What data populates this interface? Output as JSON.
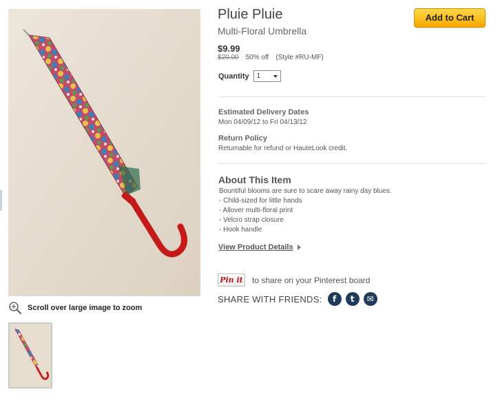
{
  "product": {
    "brand": "Pluie Pluie",
    "name": "Multi-Floral Umbrella",
    "price": "$9.99",
    "original_price": "$20.00",
    "discount": "50% off",
    "style": "(Style #RU-MF)"
  },
  "cart": {
    "add_label": "Add to Cart"
  },
  "quantity": {
    "label": "Quantity",
    "value": "1"
  },
  "delivery": {
    "title": "Estimated Delivery Dates",
    "text": "Mon 04/09/12 to Fri 04/13/12"
  },
  "returns": {
    "title": "Return Policy",
    "text": "Returnable for refund or HauteLook credit."
  },
  "about": {
    "title": "About This Item",
    "intro": "Bountiful blooms are sure to scare away rainy day blues.",
    "bullets": [
      "- Child-sized for little hands",
      "- Allover multi-floral print",
      "- Velcro strap closure",
      "- Hook handle"
    ],
    "details_link": "View Product Details"
  },
  "pinterest": {
    "button_label": "Pin it",
    "text": "to share on your Pinterest board"
  },
  "share": {
    "label": "SHARE WITH FRIENDS:",
    "icons": [
      {
        "name": "facebook-icon",
        "glyph": "f"
      },
      {
        "name": "twitter-icon",
        "glyph": "t"
      },
      {
        "name": "email-icon",
        "glyph": "✉"
      }
    ]
  },
  "image": {
    "zoom_hint": "Scroll over large image to zoom"
  },
  "colors": {
    "accent": "#f5a800",
    "background_photo": "#e6ddcf",
    "handle_red": "#c41a1a",
    "share_icon": "#1f3a5a"
  }
}
